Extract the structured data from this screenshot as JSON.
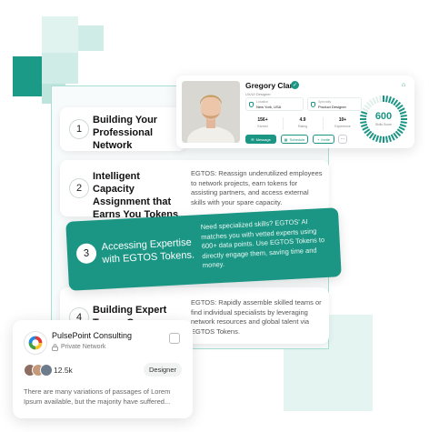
{
  "steps": [
    {
      "number": "1",
      "title": "Building Your Professional Network",
      "description": ""
    },
    {
      "number": "2",
      "title": "Intelligent Capacity Assignment that Earns You Tokens",
      "description": "EGTOS: Reassign underutilized employees to network projects, earn tokens for assisting partners, and access external skills with your spare capacity."
    },
    {
      "number": "3",
      "title": "Accessing Expertise with EGTOS Tokens.",
      "description": "Need specialized skills? EGTOS' AI matches you with vetted experts using 600+ data points. Use EGTOS Tokens to directly engage them, saving time and money."
    },
    {
      "number": "4",
      "title": "Building Expert Teams On Demand",
      "description": "EGTOS: Rapidly assemble skilled teams or find individual specialists by leveraging network resources and global talent via EGTOS Tokens."
    }
  ],
  "profile": {
    "name": "Gregory Clark",
    "role": "UX/UI Designer",
    "location_label": "Location",
    "location": "New York, USA",
    "specialty_label": "Specialty",
    "specialty": "Product Designer",
    "stats": [
      {
        "value": "156+",
        "label": "Earned"
      },
      {
        "value": "4.9",
        "label": "Rating"
      },
      {
        "value": "10+",
        "label": "Experience"
      }
    ],
    "buttons": {
      "message": "Message",
      "schedule": "Schedule",
      "invite": "Invite"
    },
    "score": {
      "value": "600",
      "label": "Skills Score",
      "fraction": 0.82
    }
  },
  "company": {
    "name": "PulsePoint Consulting",
    "type": "Private Network",
    "members": "12.5k",
    "tag": "Designer",
    "description": "There are many variations of passages of Lorem Ipsum available, but the majority have suffered..."
  },
  "colors": {
    "accent": "#1b9684",
    "accent_light": "#e1f3ef"
  }
}
